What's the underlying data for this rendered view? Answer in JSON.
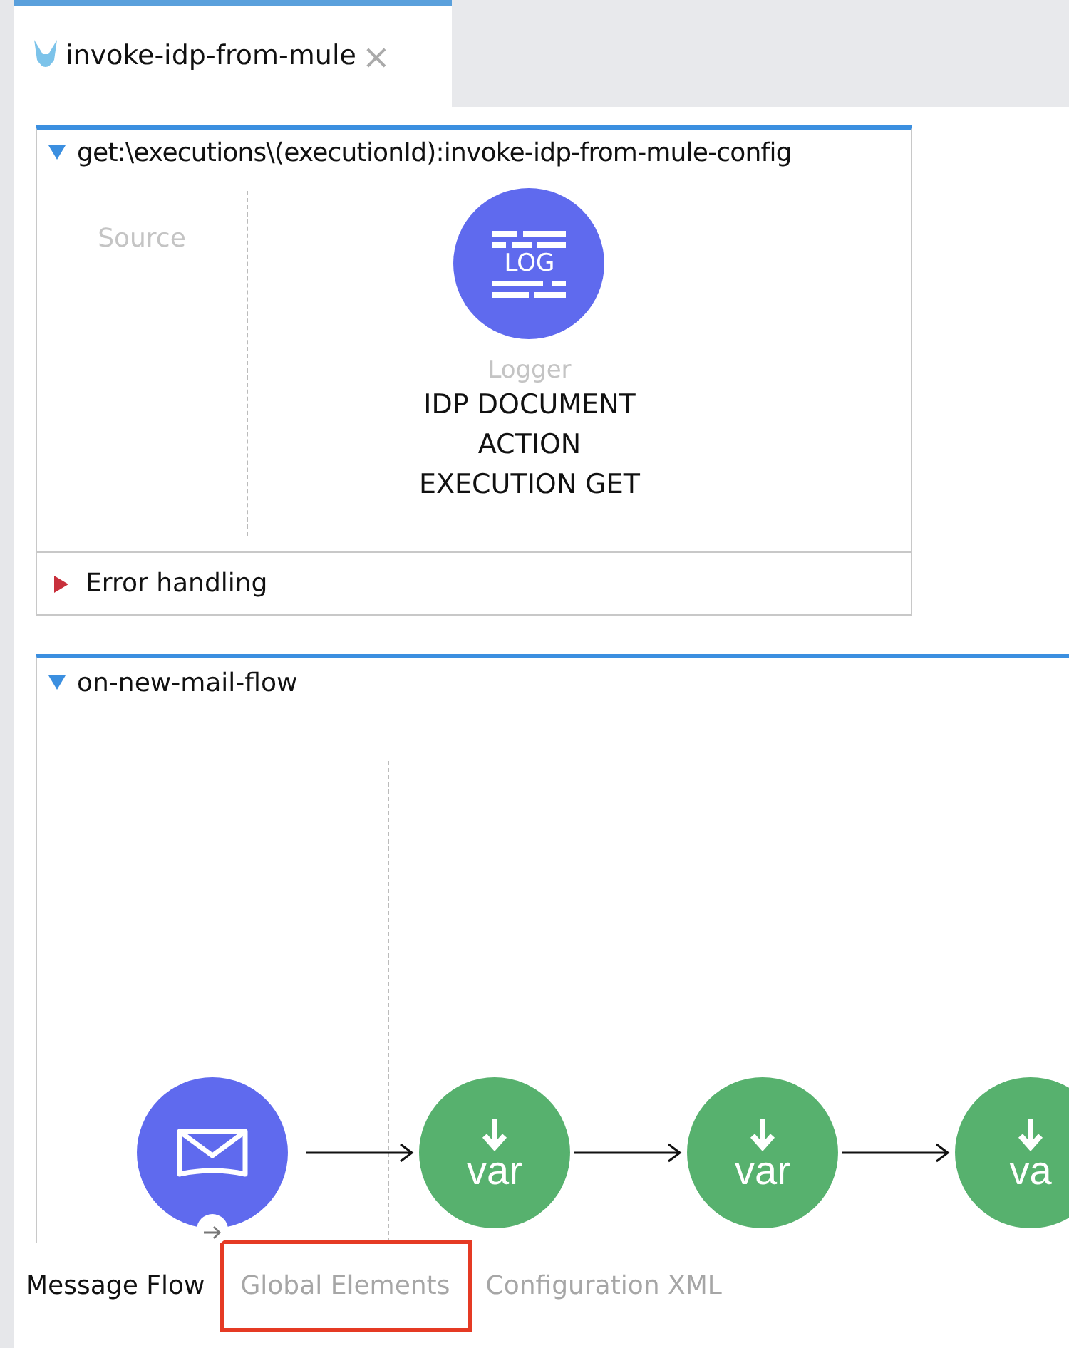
{
  "editor_tab": {
    "label": "invoke-idp-from-mule",
    "close": "×"
  },
  "flows": [
    {
      "name": "get:\\executions\\(executionId):invoke-idp-from-mule-config",
      "expanded": true,
      "source_label": "Source",
      "nodes": [
        {
          "kind": "logger",
          "glyph": "LOG",
          "type": "Logger",
          "title_lines": [
            "IDP DOCUMENT",
            "ACTION",
            "EXECUTION GET"
          ]
        }
      ],
      "error_handling": {
        "label": "Error handling",
        "expanded": false
      }
    },
    {
      "name": "on-new-mail-flow",
      "expanded": true,
      "nodes": [
        {
          "kind": "mail"
        },
        {
          "kind": "var",
          "glyph": "var"
        },
        {
          "kind": "var",
          "glyph": "var"
        },
        {
          "kind": "var",
          "glyph": "va"
        }
      ]
    }
  ],
  "bottom_tabs": [
    {
      "label": "Message Flow",
      "selected": true,
      "highlighted": false
    },
    {
      "label": "Global Elements",
      "selected": false,
      "highlighted": true
    },
    {
      "label": "Configuration XML",
      "selected": false,
      "highlighted": false
    }
  ]
}
